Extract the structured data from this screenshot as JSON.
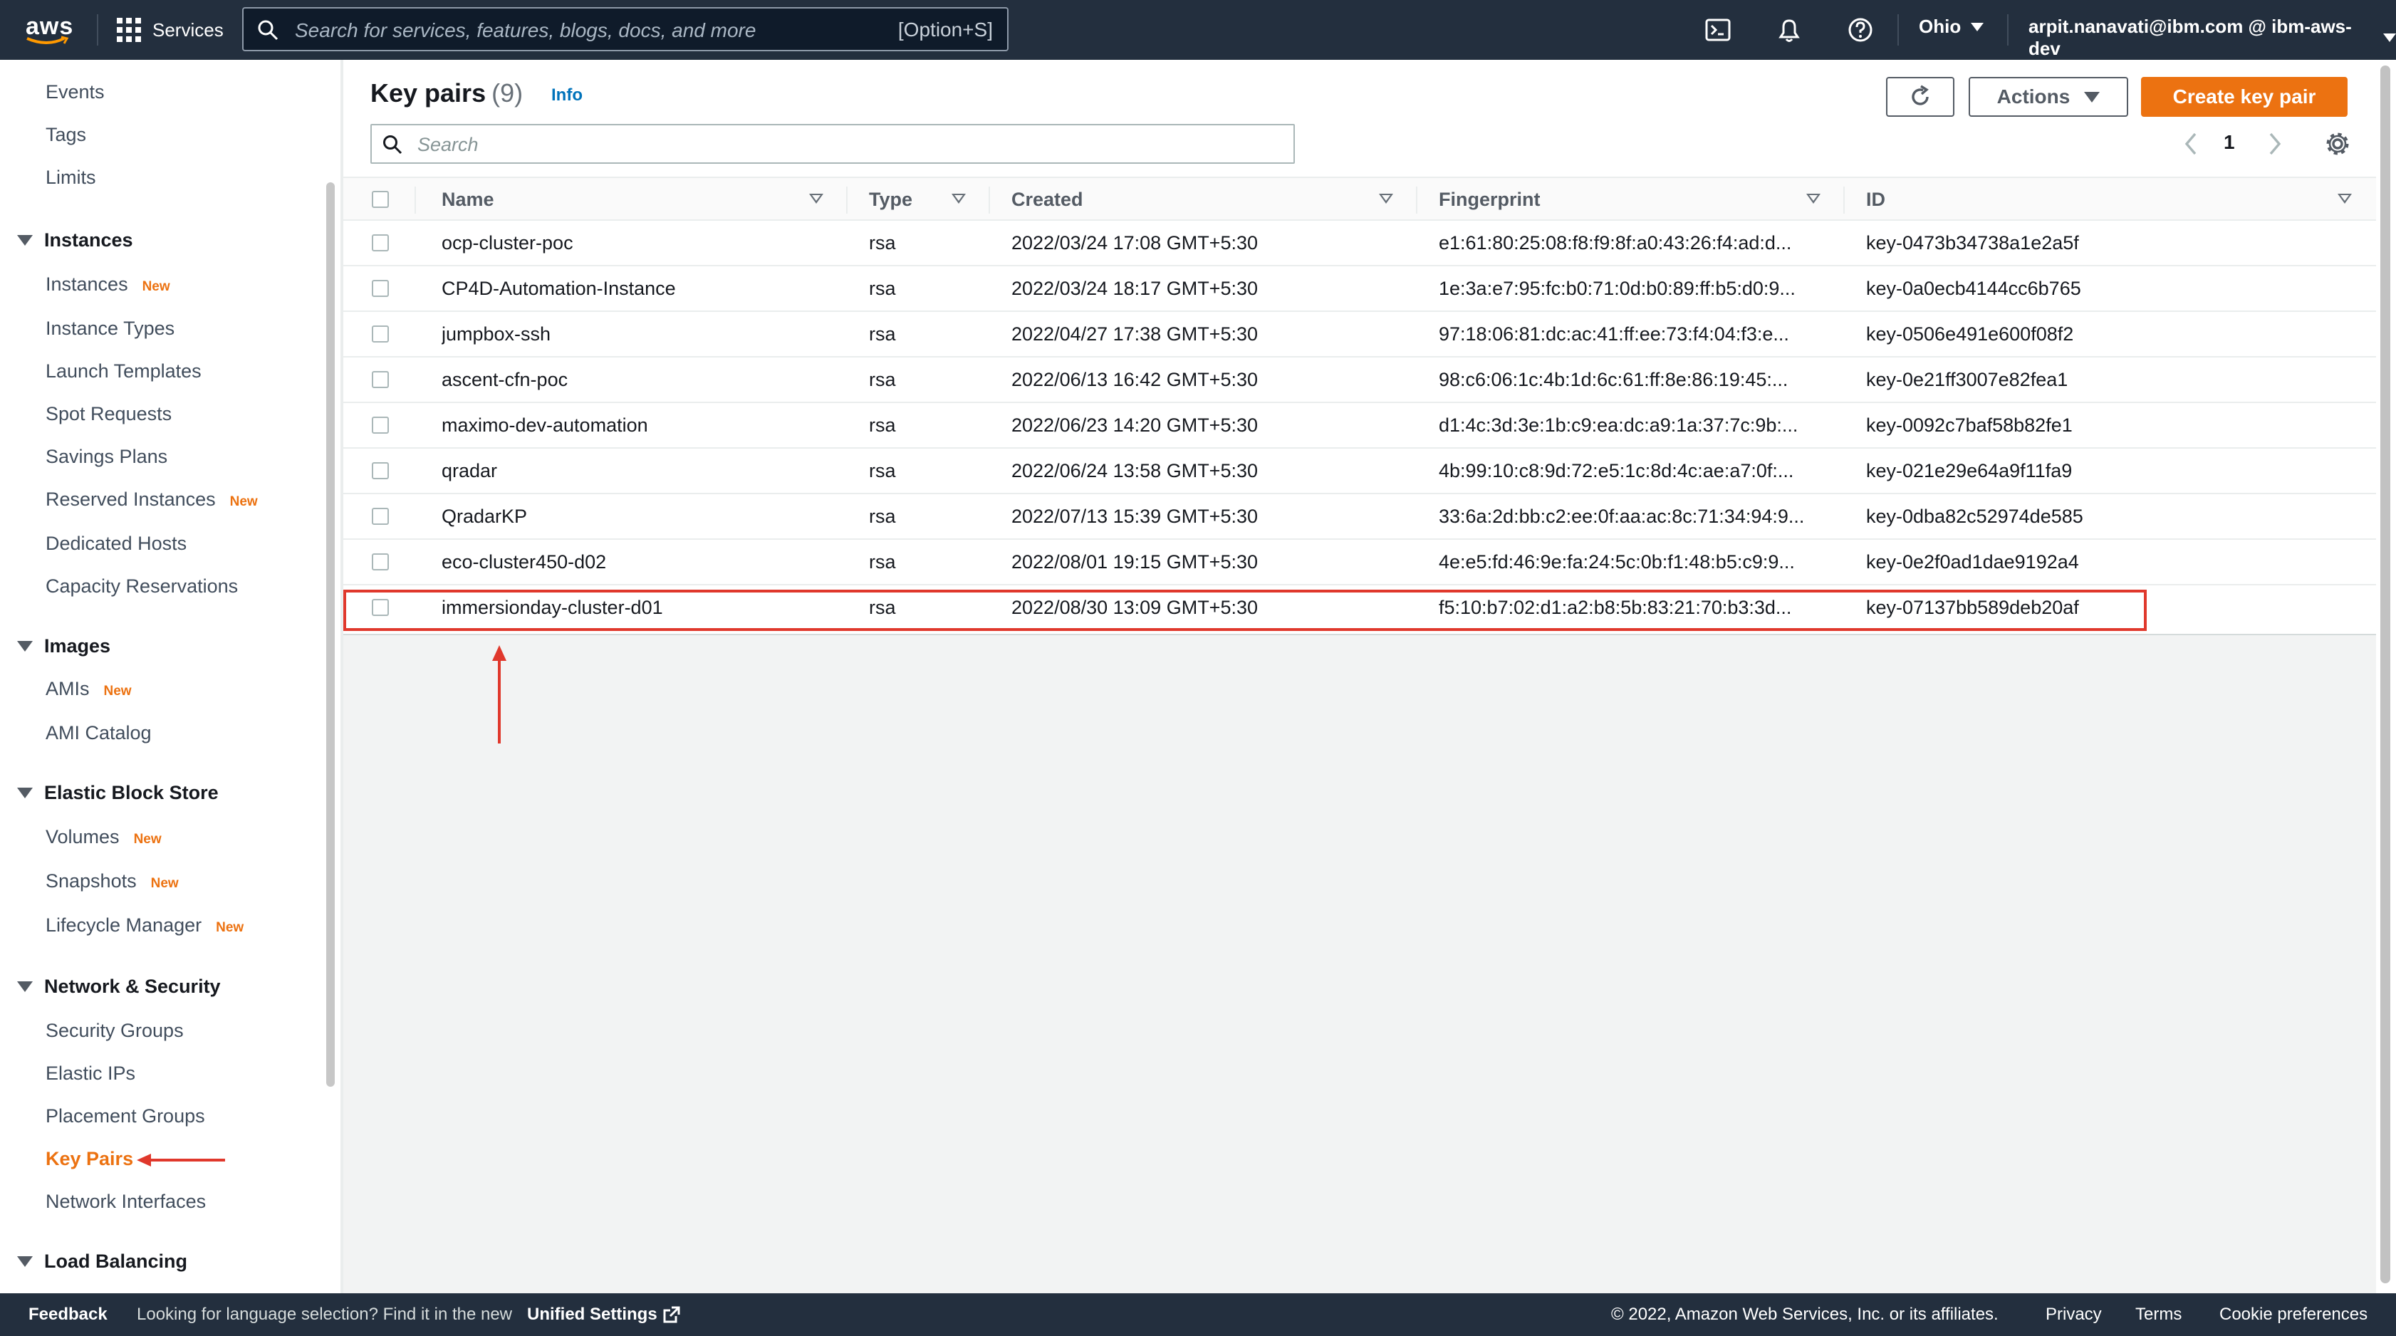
{
  "topnav": {
    "logo": "aws",
    "services_label": "Services",
    "search_placeholder": "Search for services, features, blogs, docs, and more",
    "search_shortcut": "[Option+S]",
    "icons": [
      "cloudshell-icon",
      "bell-icon",
      "help-icon"
    ],
    "region": "Ohio",
    "account": "arpit.nanavati@ibm.com @ ibm-aws-dev"
  },
  "sidebar": {
    "top_items": [
      "Events",
      "Tags",
      "Limits"
    ],
    "new_badge": "New",
    "sections": [
      {
        "title": "Instances",
        "items": [
          {
            "label": "Instances",
            "new": true
          },
          {
            "label": "Instance Types",
            "new": false
          },
          {
            "label": "Launch Templates",
            "new": false
          },
          {
            "label": "Spot Requests",
            "new": false
          },
          {
            "label": "Savings Plans",
            "new": false
          },
          {
            "label": "Reserved Instances",
            "new": true
          },
          {
            "label": "Dedicated Hosts",
            "new": false
          },
          {
            "label": "Capacity Reservations",
            "new": false
          }
        ]
      },
      {
        "title": "Images",
        "items": [
          {
            "label": "AMIs",
            "new": true
          },
          {
            "label": "AMI Catalog",
            "new": false
          }
        ]
      },
      {
        "title": "Elastic Block Store",
        "items": [
          {
            "label": "Volumes",
            "new": true
          },
          {
            "label": "Snapshots",
            "new": true
          },
          {
            "label": "Lifecycle Manager",
            "new": true
          }
        ]
      },
      {
        "title": "Network & Security",
        "items": [
          {
            "label": "Security Groups",
            "new": false
          },
          {
            "label": "Elastic IPs",
            "new": false
          },
          {
            "label": "Placement Groups",
            "new": false
          },
          {
            "label": "Key Pairs",
            "new": false,
            "active": true
          },
          {
            "label": "Network Interfaces",
            "new": false
          }
        ]
      },
      {
        "title": "Load Balancing",
        "items": []
      }
    ]
  },
  "main": {
    "title": "Key pairs",
    "count": "(9)",
    "info": "Info",
    "actions_label": "Actions",
    "create_label": "Create key pair",
    "search_placeholder": "Search",
    "page": "1",
    "columns": [
      "Name",
      "Type",
      "Created",
      "Fingerprint",
      "ID"
    ],
    "rows": [
      {
        "name": "ocp-cluster-poc",
        "type": "rsa",
        "created": "2022/03/24 17:08 GMT+5:30",
        "fingerprint": "e1:61:80:25:08:f8:f9:8f:a0:43:26:f4:ad:d...",
        "id": "key-0473b34738a1e2a5f"
      },
      {
        "name": "CP4D-Automation-Instance",
        "type": "rsa",
        "created": "2022/03/24 18:17 GMT+5:30",
        "fingerprint": "1e:3a:e7:95:fc:b0:71:0d:b0:89:ff:b5:d0:9...",
        "id": "key-0a0ecb4144cc6b765"
      },
      {
        "name": "jumpbox-ssh",
        "type": "rsa",
        "created": "2022/04/27 17:38 GMT+5:30",
        "fingerprint": "97:18:06:81:dc:ac:41:ff:ee:73:f4:04:f3:e...",
        "id": "key-0506e491e600f08f2"
      },
      {
        "name": "ascent-cfn-poc",
        "type": "rsa",
        "created": "2022/06/13 16:42 GMT+5:30",
        "fingerprint": "98:c6:06:1c:4b:1d:6c:61:ff:8e:86:19:45:...",
        "id": "key-0e21ff3007e82fea1"
      },
      {
        "name": "maximo-dev-automation",
        "type": "rsa",
        "created": "2022/06/23 14:20 GMT+5:30",
        "fingerprint": "d1:4c:3d:3e:1b:c9:ea:dc:a9:1a:37:7c:9b:...",
        "id": "key-0092c7baf58b82fe1"
      },
      {
        "name": "qradar",
        "type": "rsa",
        "created": "2022/06/24 13:58 GMT+5:30",
        "fingerprint": "4b:99:10:c8:9d:72:e5:1c:8d:4c:ae:a7:0f:...",
        "id": "key-021e29e64a9f11fa9"
      },
      {
        "name": "QradarKP",
        "type": "rsa",
        "created": "2022/07/13 15:39 GMT+5:30",
        "fingerprint": "33:6a:2d:bb:c2:ee:0f:aa:ac:8c:71:34:94:9...",
        "id": "key-0dba82c52974de585"
      },
      {
        "name": "eco-cluster450-d02",
        "type": "rsa",
        "created": "2022/08/01 19:15 GMT+5:30",
        "fingerprint": "4e:e5:fd:46:9e:fa:24:5c:0b:f1:48:b5:c9:9...",
        "id": "key-0e2f0ad1dae9192a4"
      },
      {
        "name": "immersionday-cluster-d01",
        "type": "rsa",
        "created": "2022/08/30 13:09 GMT+5:30",
        "fingerprint": "f5:10:b7:02:d1:a2:b8:5b:83:21:70:b3:3d...",
        "id": "key-07137bb589deb20af"
      }
    ]
  },
  "footer": {
    "feedback": "Feedback",
    "lang_text": "Looking for language selection? Find it in the new",
    "unified_settings": "Unified Settings",
    "copyright": "© 2022, Amazon Web Services, Inc. or its affiliates.",
    "privacy": "Privacy",
    "terms": "Terms",
    "cookies": "Cookie preferences"
  },
  "colors": {
    "accent": "#ec7211",
    "nav_bg": "#232f3e",
    "link": "#0073bb",
    "annotation_red": "#e0382c"
  }
}
